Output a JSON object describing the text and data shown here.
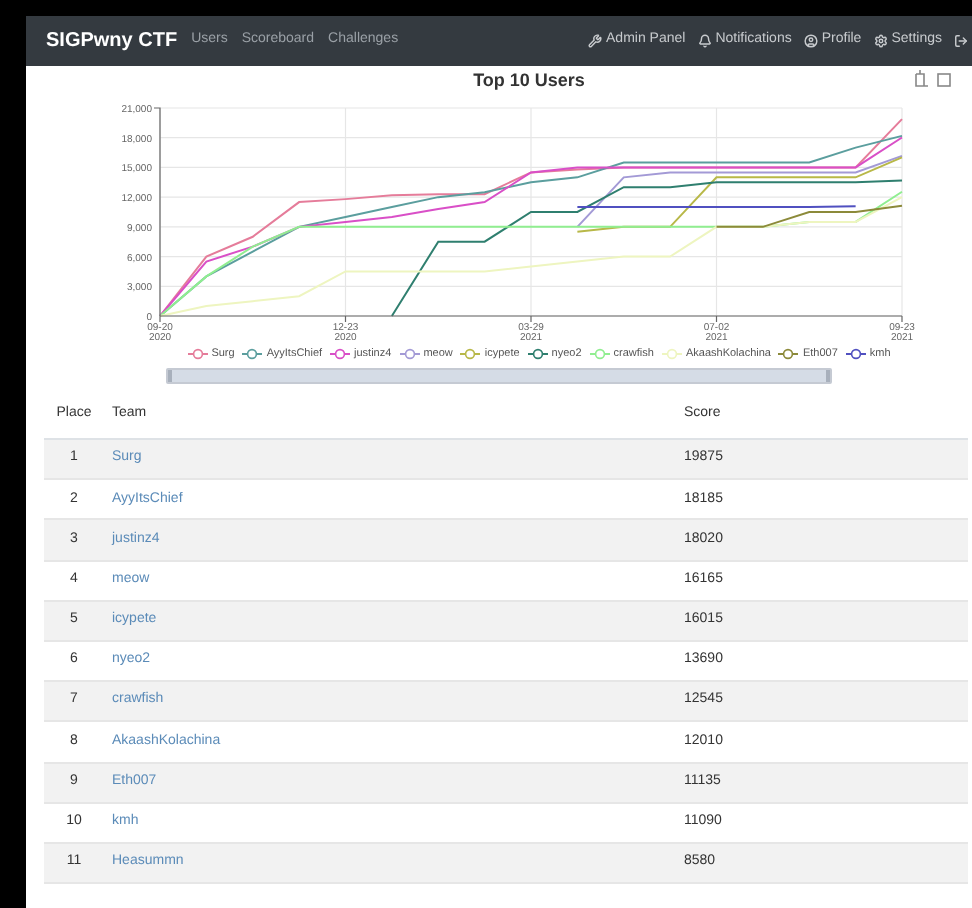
{
  "navbar": {
    "brand": "SIGPwny CTF",
    "links": [
      {
        "label": "Users"
      },
      {
        "label": "Scoreboard"
      },
      {
        "label": "Challenges"
      }
    ],
    "right_links": [
      {
        "label": "Admin Panel",
        "kind": "wrench"
      },
      {
        "label": "Notifications",
        "kind": "bell"
      },
      {
        "label": "Profile",
        "kind": "user"
      },
      {
        "label": "Settings",
        "kind": "cogs"
      },
      {
        "kind": "logout"
      }
    ]
  },
  "chart": {
    "chart_data": {
      "type": "line",
      "title": "Top 10 Users",
      "categories": [
        "09-20 2020",
        null,
        null,
        null,
        "12-23 2020",
        null,
        null,
        null,
        "03-29 2021",
        null,
        null,
        null,
        "07-02 2021",
        null,
        null,
        null,
        "09-23 2021"
      ],
      "yticks": [
        {
          "value": 0,
          "label": "0"
        },
        {
          "value": 3000,
          "label": "3,000"
        },
        {
          "value": 6000,
          "label": "6,000"
        },
        {
          "value": 9000,
          "label": "9,000"
        },
        {
          "value": 12000,
          "label": "12,000"
        },
        {
          "value": 15000,
          "label": "15,000"
        },
        {
          "value": 18000,
          "label": "18,000"
        },
        {
          "value": 21000,
          "label": "21,000"
        }
      ],
      "ylim": [
        0,
        21000
      ],
      "grid": true,
      "legend": "bottom",
      "series": [
        {
          "name": "Surg",
          "color": "#e57c9a",
          "values": [
            0,
            6000,
            8000,
            11500,
            11800,
            12200,
            12300,
            12300,
            14500,
            14800,
            15000,
            15000,
            15000,
            15000,
            15000,
            15000,
            19875
          ]
        },
        {
          "name": "AyyItsChief",
          "color": "#5b9e9e",
          "values": [
            0,
            4000,
            6500,
            9000,
            10000,
            11000,
            12000,
            12500,
            13500,
            14000,
            15500,
            15500,
            15500,
            15500,
            15500,
            17000,
            18185
          ]
        },
        {
          "name": "justinz4",
          "color": "#d94fc7",
          "values": [
            0,
            5500,
            7000,
            9000,
            9500,
            10000,
            10800,
            11500,
            14500,
            15000,
            15000,
            15000,
            15000,
            15000,
            15000,
            15000,
            18020
          ]
        },
        {
          "name": "meow",
          "color": "#a39ad6",
          "values": [
            null,
            null,
            null,
            null,
            null,
            null,
            null,
            null,
            null,
            9000,
            14000,
            14500,
            14500,
            14500,
            14500,
            14500,
            16165
          ]
        },
        {
          "name": "icypete",
          "color": "#b8b848",
          "values": [
            null,
            null,
            null,
            null,
            null,
            null,
            null,
            null,
            null,
            8500,
            9000,
            9000,
            14000,
            14000,
            14000,
            14000,
            16015
          ]
        },
        {
          "name": "nyeo2",
          "color": "#2f7f6f",
          "values": [
            null,
            null,
            null,
            null,
            null,
            0,
            7500,
            7500,
            10500,
            10500,
            13000,
            13000,
            13500,
            13500,
            13500,
            13500,
            13690
          ]
        },
        {
          "name": "crawfish",
          "color": "#90ee90",
          "values": [
            0,
            4000,
            7000,
            9000,
            9000,
            9000,
            9000,
            9000,
            9000,
            9000,
            9000,
            9000,
            9000,
            9000,
            9500,
            9500,
            12545
          ]
        },
        {
          "name": "AkaashKolachina",
          "color": "#eef5c0",
          "values": [
            0,
            1000,
            1500,
            2000,
            4500,
            4500,
            4500,
            4500,
            5000,
            5500,
            6000,
            6000,
            9000,
            9000,
            9500,
            9500,
            12010
          ]
        },
        {
          "name": "Eth007",
          "color": "#8c8a3a",
          "values": [
            null,
            null,
            null,
            null,
            null,
            null,
            null,
            null,
            null,
            null,
            null,
            null,
            9000,
            9000,
            10500,
            10500,
            11135
          ]
        },
        {
          "name": "kmh",
          "color": "#5050c0",
          "values": [
            null,
            null,
            null,
            null,
            null,
            null,
            null,
            null,
            null,
            11000,
            11000,
            11000,
            11000,
            11000,
            11000,
            11090,
            null
          ]
        }
      ]
    }
  },
  "table": {
    "columns": [
      "Place",
      "Team",
      "Score"
    ],
    "rows": [
      {
        "place": "1",
        "team": "Surg",
        "score": "19875"
      },
      {
        "place": "2",
        "team": "AyyItsChief",
        "score": "18185"
      },
      {
        "place": "3",
        "team": "justinz4",
        "score": "18020"
      },
      {
        "place": "4",
        "team": "meow",
        "score": "16165"
      },
      {
        "place": "5",
        "team": "icypete",
        "score": "16015"
      },
      {
        "place": "6",
        "team": "nyeo2",
        "score": "13690"
      },
      {
        "place": "7",
        "team": "crawfish",
        "score": "12545"
      },
      {
        "place": "8",
        "team": "AkaashKolachina",
        "score": "12010"
      },
      {
        "place": "9",
        "team": "Eth007",
        "score": "11135"
      },
      {
        "place": "10",
        "team": "kmh",
        "score": "11090"
      },
      {
        "place": "11",
        "team": "Heasummn",
        "score": "8580"
      }
    ]
  }
}
